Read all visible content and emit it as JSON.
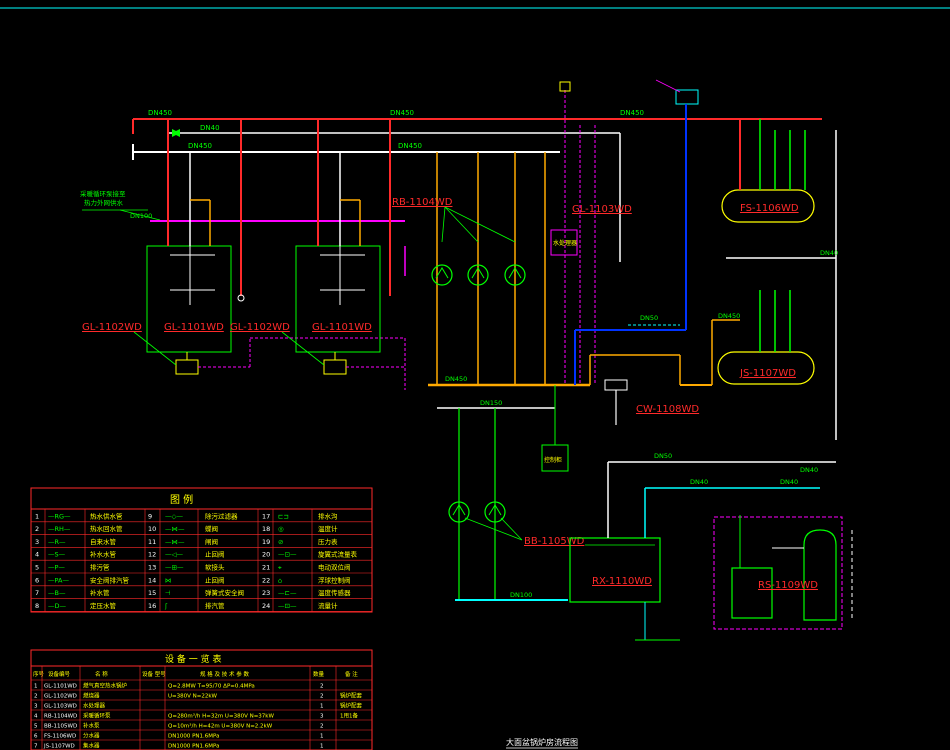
{
  "drawing": {
    "title": "大面盆锅炉房流程图",
    "pipe_labels": {
      "dn450_top_left": "DN450",
      "dn450_top_mid": "DN450",
      "dn450_top_right": "DN450",
      "dn40_top": "DN40",
      "dn450_second": "DN450",
      "dn450_second_mid": "DN450",
      "dn100_left": "DN100",
      "dn40_right": "DN40",
      "dn450_js": "DN450",
      "dn450_pump_header": "DN450",
      "dn50_mid": "DN50",
      "dn150_low": "DN150",
      "dn50_low": "DN50",
      "dn40_low_a": "DN40",
      "dn40_low_b": "DN40",
      "dn40_far_right": "DN40",
      "dn100_bottom": "DN100"
    },
    "note_left": "采暖循环泵接至\n热力外网供水",
    "equipment_tags": {
      "gl_1101_a": "GL-1101WD",
      "gl_1101_b": "GL-1101WD",
      "gl_1102_a": "GL-1102WD",
      "gl_1102_b": "GL-1102WD",
      "rb_1104": "RB-1104WD",
      "gl_1103": "GL-1103WD",
      "fs_1106": "FS-1106WD",
      "js_1107": "JS-1107WD",
      "cw_1108": "CW-1108WD",
      "bb_1105": "BB-1105WD",
      "rx_1110": "RX-1110WD",
      "rs_1109": "RS-1109WD"
    },
    "boxes": {
      "water_treatment": "水处理器",
      "control_cabinet": "控制柜"
    }
  },
  "legend": {
    "title": "图 例",
    "rows": [
      {
        "n1": "1",
        "s1": "—RG—",
        "t1": "热水供水管",
        "n2": "9",
        "s2": "—◇—",
        "t2": "除污过滤器",
        "n3": "17",
        "s3": "⊏⊐",
        "t3": "排水沟"
      },
      {
        "n1": "2",
        "s1": "—RH—",
        "t1": "热水回水管",
        "n2": "10",
        "s2": "—⋈—",
        "t2": "蝶阀",
        "n3": "18",
        "s3": "◎",
        "t3": "温度计"
      },
      {
        "n1": "3",
        "s1": "—R—",
        "t1": "自来水管",
        "n2": "11",
        "s2": "—⋈—",
        "t2": "闸阀",
        "n3": "19",
        "s3": "⊘",
        "t3": "压力表"
      },
      {
        "n1": "4",
        "s1": "—S—",
        "t1": "补水水管",
        "n2": "12",
        "s2": "—◁—",
        "t2": "止回阀",
        "n3": "20",
        "s3": "—⊡—",
        "t3": "旋翼式流量表"
      },
      {
        "n1": "5",
        "s1": "—P—",
        "t1": "排污管",
        "n2": "13",
        "s2": "—⊞—",
        "t2": "软接头",
        "n3": "21",
        "s3": "⌖",
        "t3": "电动双位阀"
      },
      {
        "n1": "6",
        "s1": "—PA—",
        "t1": "安全阀排汽管",
        "n2": "14",
        "s2": "⋈",
        "t2": "止回阀",
        "n3": "22",
        "s3": "⌂",
        "t3": "浮球控制阀"
      },
      {
        "n1": "7",
        "s1": "—B—",
        "t1": "补水管",
        "n2": "15",
        "s2": "⊣",
        "t2": "弹簧式安全阀",
        "n3": "23",
        "s3": "—⊏—",
        "t3": "温度传感器"
      },
      {
        "n1": "8",
        "s1": "—D—",
        "t1": "定压水管",
        "n2": "16",
        "s2": "ʃ",
        "t2": "排汽管",
        "n3": "24",
        "s3": "—⊡—",
        "t3": "流量计"
      }
    ]
  },
  "equipment_table": {
    "title": "设 备 一 览 表",
    "headers": [
      "序号",
      "设备编号",
      "名 称",
      "设备 型号",
      "规 格 及 技 术 参 数",
      "数量",
      "备 注"
    ],
    "rows": [
      {
        "no": "1",
        "code": "GL-1101WD",
        "name": "燃气真空热水锅炉",
        "spec": "Q=2.8MW T=95/70 ΔP=0.4MPa",
        "qty": "2",
        "note": ""
      },
      {
        "no": "2",
        "code": "GL-1102WD",
        "name": "燃烧器",
        "spec": "U=380V N=22kW",
        "qty": "2",
        "note": "锅炉配套"
      },
      {
        "no": "3",
        "code": "GL-1103WD",
        "name": "水处理器",
        "spec": "",
        "qty": "1",
        "note": "锅炉配套"
      },
      {
        "no": "4",
        "code": "RB-1104WD",
        "name": "采暖循环泵",
        "spec": "Q=280m³/h H=32m U=380V N=37kW",
        "qty": "3",
        "note": "1用1备"
      },
      {
        "no": "5",
        "code": "BB-1105WD",
        "name": "补水泵",
        "spec": "Q=10m³/h H=42m U=380V N=2.2kW",
        "qty": "2",
        "note": ""
      },
      {
        "no": "6",
        "code": "FS-1106WD",
        "name": "分水器",
        "spec": "DN1000 PN1.6MPa",
        "qty": "1",
        "note": ""
      },
      {
        "no": "7",
        "code": "JS-1107WD",
        "name": "集水器",
        "spec": "DN1000 PN1.6MPa",
        "qty": "1",
        "note": ""
      }
    ]
  }
}
